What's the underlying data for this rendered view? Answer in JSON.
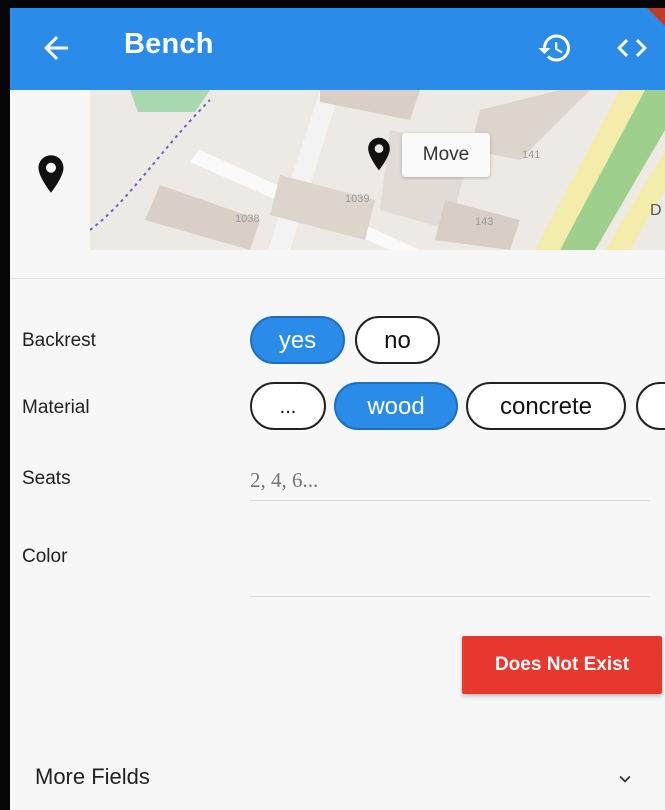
{
  "app_bar": {
    "title": "Bench",
    "back_icon": "arrow-left-icon",
    "history_icon": "history-icon",
    "code_icon": "code-icon",
    "color": "#2b8be8"
  },
  "map": {
    "move_label": "Move",
    "building_numbers": [
      "1038",
      "1039",
      "143",
      "141"
    ],
    "road_label": "D"
  },
  "fields": {
    "backrest": {
      "label": "Backrest",
      "options": [
        "yes",
        "no"
      ],
      "selected": "yes"
    },
    "material": {
      "label": "Material",
      "options": [
        "...",
        "wood",
        "concrete"
      ],
      "selected": "wood"
    },
    "seats": {
      "label": "Seats",
      "value": "",
      "placeholder": "2, 4, 6..."
    },
    "color": {
      "label": "Color",
      "value": "",
      "placeholder": ""
    }
  },
  "actions": {
    "does_not_exist": "Does Not Exist",
    "does_not_exist_color": "#e8372d"
  },
  "more_fields": {
    "label": "More Fields",
    "icon": "chevron-down-icon"
  }
}
